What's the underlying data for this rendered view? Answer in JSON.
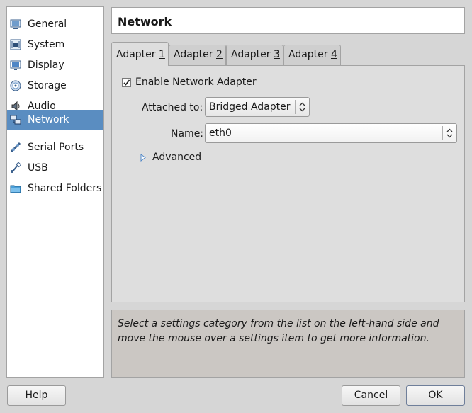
{
  "sidebar": {
    "items": [
      {
        "label": "General",
        "icon": "general-icon"
      },
      {
        "label": "System",
        "icon": "system-icon"
      },
      {
        "label": "Display",
        "icon": "display-icon"
      },
      {
        "label": "Storage",
        "icon": "storage-icon"
      },
      {
        "label": "Audio",
        "icon": "audio-icon"
      },
      {
        "label": "Network",
        "icon": "network-icon",
        "selected": true
      },
      {
        "label": "Serial Ports",
        "icon": "serial-ports-icon"
      },
      {
        "label": "USB",
        "icon": "usb-icon"
      },
      {
        "label": "Shared Folders",
        "icon": "shared-folders-icon"
      }
    ]
  },
  "header": {
    "title": "Network"
  },
  "tabs": [
    {
      "prefix": "Adapter ",
      "num": "1",
      "active": true
    },
    {
      "prefix": "Adapter ",
      "num": "2"
    },
    {
      "prefix": "Adapter ",
      "num": "3"
    },
    {
      "prefix": "Adapter ",
      "num": "4"
    }
  ],
  "adapter": {
    "enable_label": "Enable Network Adapter",
    "enabled": true,
    "attached_label": "Attached to:",
    "attached_value": "Bridged Adapter",
    "name_label": "Name:",
    "name_value": "eth0",
    "advanced_label": "Advanced"
  },
  "info": {
    "text": "Select a settings category from the list on the left-hand side and move the mouse over a settings item to get more information."
  },
  "buttons": {
    "help": "Help",
    "cancel": "Cancel",
    "ok": "OK"
  },
  "colors": {
    "selection": "#5a8dc1",
    "info_bg": "#cbc7c3",
    "window_bg": "#d6d6d6"
  }
}
